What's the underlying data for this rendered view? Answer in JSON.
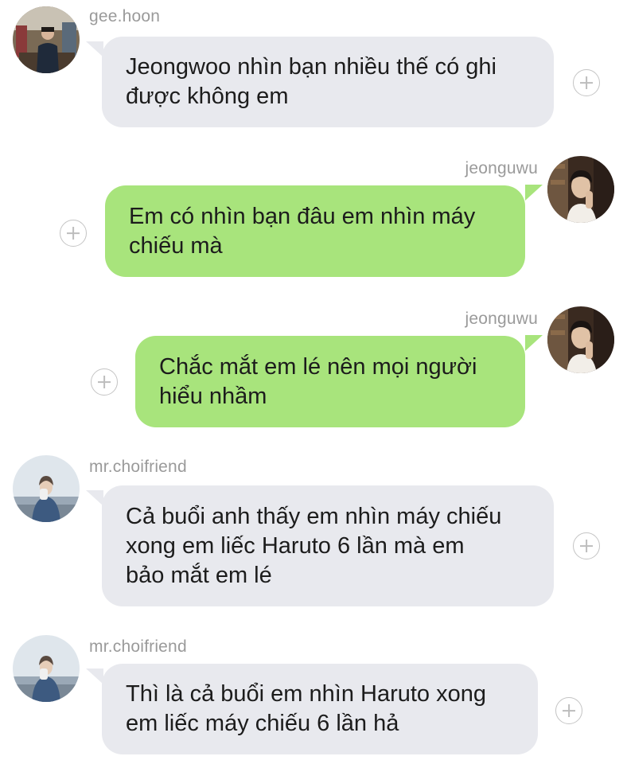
{
  "messages": [
    {
      "sender": "gee.hoon",
      "direction": "incoming",
      "avatar": "photo of man in a suit in a store",
      "lines": [
        "Jeongwoo nhìn bạn nhiều thế có ghi",
        "được không em"
      ]
    },
    {
      "sender": "jeonguwu",
      "direction": "outgoing",
      "avatar": "photo of young man with hand on chin",
      "lines": [
        "Em có nhìn bạn đâu em nhìn máy",
        "chiếu mà"
      ]
    },
    {
      "sender": "jeonguwu",
      "direction": "outgoing",
      "avatar": "photo of young man with hand on chin",
      "lines": [
        "Chắc mắt em lé nên mọi người",
        "hiểu nhầm"
      ]
    },
    {
      "sender": "mr.choifriend",
      "direction": "incoming",
      "avatar": "photo of person in denim jacket against sky",
      "lines": [
        "Cả buổi anh thấy em nhìn máy chiếu",
        "xong em liếc Haruto 6 lần mà em",
        "bảo mắt em lé"
      ]
    },
    {
      "sender": "mr.choifriend",
      "direction": "incoming",
      "avatar": "photo of person in denim jacket against sky",
      "lines": [
        "Thì là cả buổi em nhìn Haruto xong",
        "em liếc máy chiếu 6 lần hả"
      ]
    }
  ],
  "icons": {
    "add": "plus-circle-icon"
  },
  "colors": {
    "incoming_bubble": "#e8e9ee",
    "outgoing_bubble": "#a8e47c",
    "sender_text": "#9a9a9a",
    "message_text": "#1c1c1c",
    "add_icon": "#c4c4c4"
  }
}
